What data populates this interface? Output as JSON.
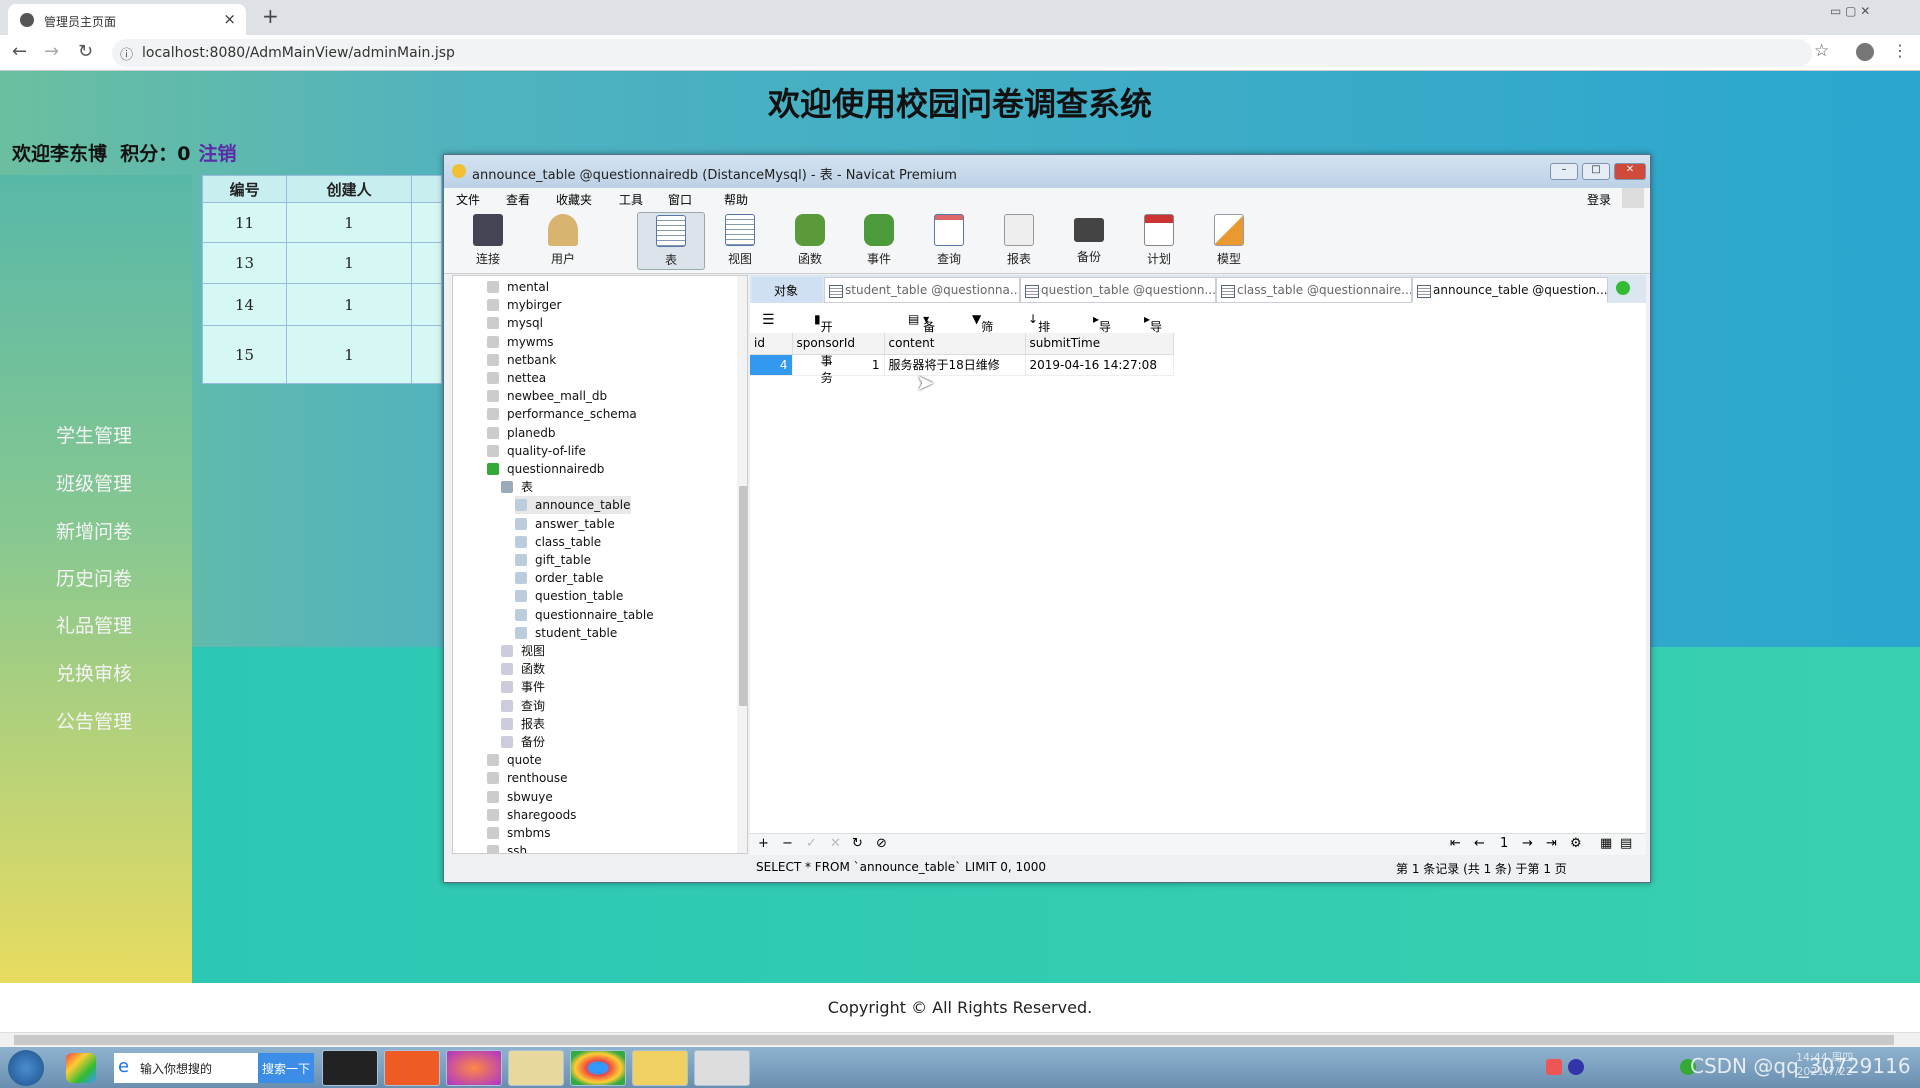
{
  "browser": {
    "tab_title": "管理员主页面",
    "url": "localhost:8080/AdmMainView/adminMain.jsp"
  },
  "page": {
    "title": "欢迎使用校园问卷调查系统",
    "welcome": "欢迎李东博",
    "points_label": "积分：0",
    "logout": "注销",
    "table": {
      "headers": [
        "编号",
        "创建人"
      ],
      "rows": [
        [
          "11",
          "1"
        ],
        [
          "13",
          "1"
        ],
        [
          "14",
          "1"
        ],
        [
          "15",
          "1"
        ]
      ]
    },
    "nav": [
      "学生管理",
      "班级管理",
      "新增问卷",
      "历史问卷",
      "礼品管理",
      "兑换审核",
      "公告管理"
    ],
    "footer": "Copyright © All Rights Reserved."
  },
  "navicat": {
    "title": "announce_table @questionnairedb (DistanceMysql) - 表 - Navicat Premium",
    "menu": [
      "文件",
      "查看",
      "收藏夹",
      "工具",
      "窗口",
      "帮助"
    ],
    "login": "登录",
    "tools": [
      "连接",
      "用户",
      "表",
      "视图",
      "函数",
      "事件",
      "查询",
      "报表",
      "备份",
      "计划",
      "模型"
    ],
    "tree_dbs_top": [
      "mental",
      "mybirger",
      "mysql",
      "mywms",
      "netbank",
      "nettea",
      "newbee_mall_db",
      "performance_schema",
      "planedb",
      "quality-of-life",
      "questionnairedb"
    ],
    "tree_tables_label": "表",
    "tree_tables": [
      "announce_table",
      "answer_table",
      "class_table",
      "gift_table",
      "order_table",
      "question_table",
      "questionnaire_table",
      "student_table"
    ],
    "tree_groups": [
      "视图",
      "函数",
      "事件",
      "查询",
      "报表",
      "备份"
    ],
    "tree_dbs_bottom": [
      "quote",
      "renthouse",
      "sbwuye",
      "sharegoods",
      "smbms",
      "ssh"
    ],
    "object_tab": "对象",
    "tabs": [
      "student_table @questionna...",
      "question_table @questionn...",
      "class_table @questionnaire...",
      "announce_table @question..."
    ],
    "subtoolbar": [
      "开始事务",
      "备注",
      "筛选",
      "排序",
      "导入",
      "导出"
    ],
    "grid": {
      "columns": [
        "id",
        "sponsorId",
        "content",
        "submitTime"
      ],
      "rows": [
        [
          "4",
          "1",
          "服务器将于18日维修",
          "2019-04-16 14:27:08"
        ]
      ]
    },
    "page_number": "1",
    "sql": "SELECT * FROM `announce_table` LIMIT 0, 1000",
    "record_status": "第 1 条记录 (共 1 条) 于第 1 页"
  },
  "taskbar": {
    "search_placeholder": "输入你想搜的",
    "search_button": "搜索一下",
    "watermark": "CSDN @qq_30729116",
    "clock_time": "14:44 周四",
    "clock_date": "2021/7/22"
  }
}
